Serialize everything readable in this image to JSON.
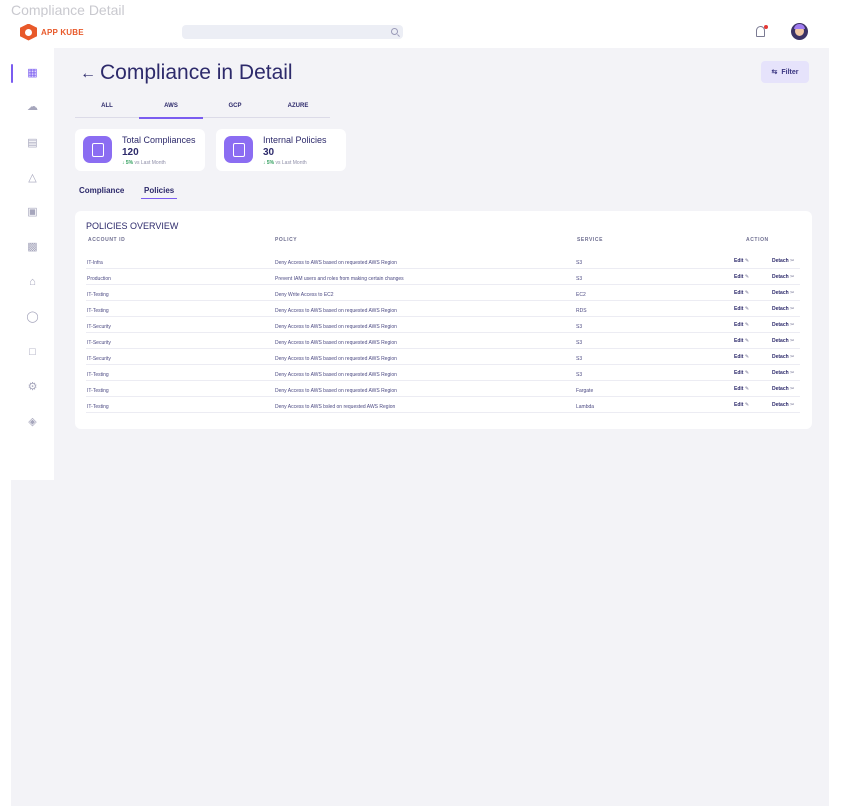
{
  "frame": {
    "title": "Compliance Detail"
  },
  "topbar": {
    "logo_text": "APP KUBE",
    "search": {
      "placeholder": ""
    },
    "icons": [
      "search-icon",
      "bell-icon",
      "avatar"
    ],
    "notification_dot_color": "#e53935"
  },
  "sidebar": {
    "items": [
      {
        "icon": "dashboard-icon",
        "active": true
      },
      {
        "icon": "cloud-icon"
      },
      {
        "icon": "clipboard-icon"
      },
      {
        "icon": "rocket-icon"
      },
      {
        "icon": "report-icon"
      },
      {
        "icon": "chip-icon"
      },
      {
        "icon": "house-icon"
      },
      {
        "icon": "shield-icon"
      },
      {
        "icon": "square-icon"
      },
      {
        "icon": "users-icon"
      },
      {
        "icon": "layers-icon"
      }
    ]
  },
  "header": {
    "title": "Compliance in Detail",
    "filter_label": "Filter"
  },
  "cloud_tabs": [
    {
      "label": "ALL"
    },
    {
      "label": "AWS",
      "active": true
    },
    {
      "label": "GCP"
    },
    {
      "label": "AZURE"
    }
  ],
  "stats": [
    {
      "label": "Total Compliances",
      "value": "120",
      "trend": "5%",
      "trend_note": "vs Last Month"
    },
    {
      "label": "Internal Policies",
      "value": "30",
      "trend": "5%",
      "trend_note": "vs Last Month"
    }
  ],
  "sub_tabs": [
    {
      "label": "Compliance"
    },
    {
      "label": "Policies",
      "active": true
    }
  ],
  "policies": {
    "title": "POLICIES OVERVIEW",
    "columns": [
      "ACCOUNT ID",
      "POLICY",
      "SERVICE",
      "ACTION"
    ],
    "edit_label": "Edit",
    "detach_label": "Detach",
    "rows": [
      {
        "account": "IT-Infra",
        "policy": "Deny Access to AWS based on requested AWS Region",
        "service": "S3"
      },
      {
        "account": "Production",
        "policy": "Prevent IAM users and roles from making certain changes",
        "service": "S3"
      },
      {
        "account": "IT-Testing",
        "policy": "Deny Write Access to EC2",
        "service": "EC2"
      },
      {
        "account": "IT-Testing",
        "policy": "Deny Access to AWS based on requested AWS Region",
        "service": "RDS"
      },
      {
        "account": "IT-Security",
        "policy": "Deny Access to AWS based on requested AWS Region",
        "service": "S3"
      },
      {
        "account": "IT-Security",
        "policy": "Deny Access to AWS based on requested AWS Region",
        "service": "S3"
      },
      {
        "account": "IT-Security",
        "policy": "Deny Access to AWS based on requested AWS Region",
        "service": "S3"
      },
      {
        "account": "IT-Testing",
        "policy": "Deny Access to AWS based on requested AWS Region",
        "service": "S3"
      },
      {
        "account": "IT-Testing",
        "policy": "Deny Access to AWS based on requested AWS Region",
        "service": "Fargate"
      },
      {
        "account": "IT-Testing",
        "policy": "Deny Access to AWS bsled on requested AWS Region",
        "service": "Lambda"
      }
    ]
  },
  "colors": {
    "accent": "#7a5cf0",
    "brand": "#e8592a",
    "trend_up": "#2e9e5b",
    "background": "#f3f3f7"
  }
}
